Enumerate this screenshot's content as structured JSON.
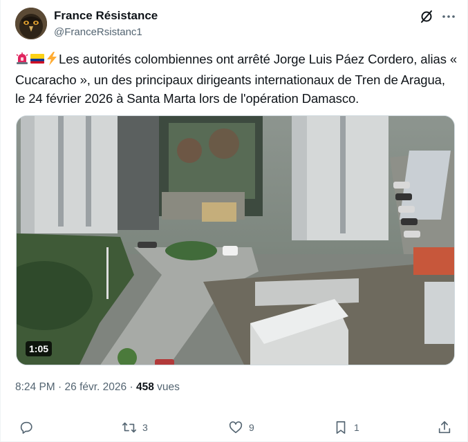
{
  "author": {
    "display_name": "France Résistance",
    "handle": "@FranceRsistanc1",
    "avatar_icon": "eagle-avatar"
  },
  "header_icons": {
    "grok": "grok-icon",
    "more": "more-icon"
  },
  "tweet": {
    "emojis": [
      "rotating-light-emoji",
      "colombia-flag-emoji",
      "high-voltage-emoji"
    ],
    "text": "Les autorités colombiennes ont arrêté Jorge Luis Páez Cordero, alias « Cucaracho », un des principaux dirigeants internationaux de Tren de Aragua, le 24 février 2026 à Santa Marta lors de l'opération Damasco."
  },
  "media": {
    "type": "video",
    "duration": "1:05"
  },
  "meta": {
    "time": "8:24 PM",
    "separator": "·",
    "date": "26 févr. 2026",
    "views_count": "458",
    "views_label": "vues"
  },
  "actions": {
    "reply": {
      "icon": "reply-icon",
      "count": ""
    },
    "repost": {
      "icon": "repost-icon",
      "count": "3"
    },
    "like": {
      "icon": "like-icon",
      "count": "9"
    },
    "bookmark": {
      "icon": "bookmark-icon",
      "count": "1"
    },
    "share": {
      "icon": "share-icon",
      "count": ""
    }
  },
  "colors": {
    "text": "#0f1419",
    "secondary": "#536471",
    "border": "#cfd9de"
  }
}
